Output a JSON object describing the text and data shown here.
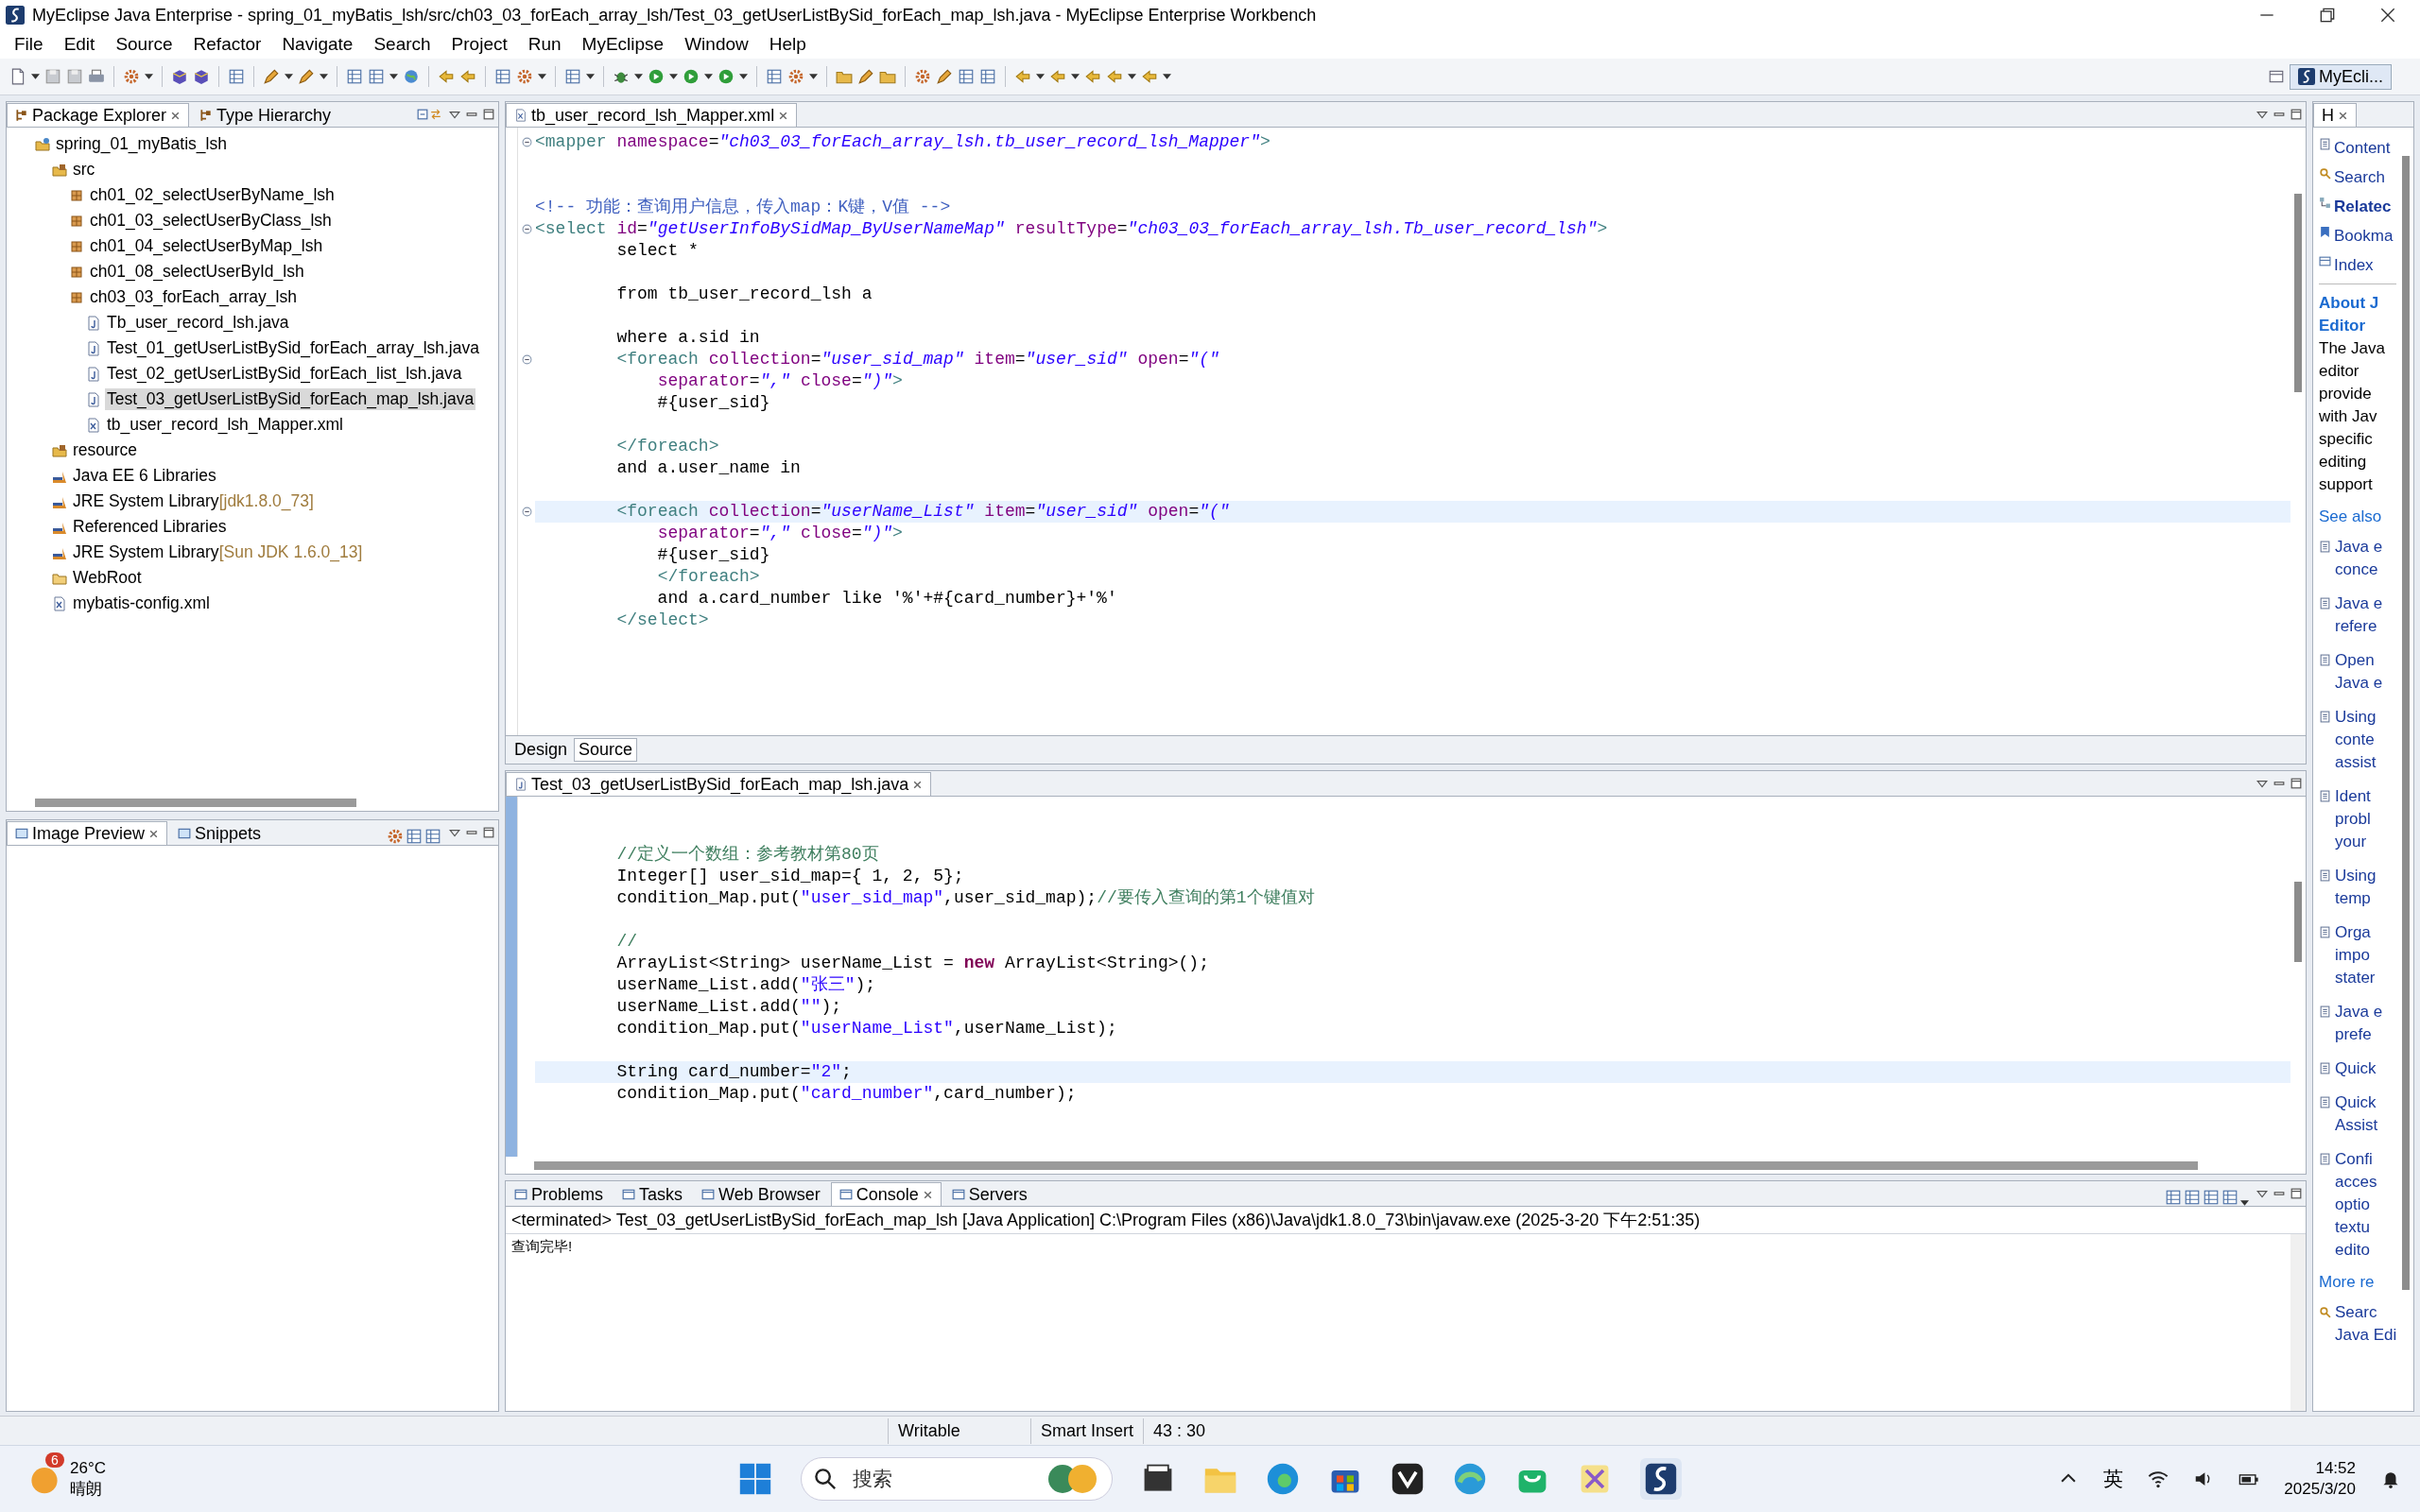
{
  "window": {
    "title": "MyEclipse Java Enterprise - spring_01_myBatis_lsh/src/ch03_03_forEach_array_lsh/Test_03_getUserListBySid_forEach_map_lsh.java - MyEclipse Enterprise Workbench"
  },
  "menu": [
    "File",
    "Edit",
    "Source",
    "Refactor",
    "Navigate",
    "Search",
    "Project",
    "Run",
    "MyEclipse",
    "Window",
    "Help"
  ],
  "perspective": {
    "label": "MyEcli..."
  },
  "explorer": {
    "tabs": [
      {
        "label": "Package Explorer",
        "selected": true
      },
      {
        "label": "Type Hierarchy",
        "selected": false
      }
    ],
    "tree": [
      {
        "label": "spring_01_myBatis_lsh",
        "kind": "project",
        "selected": false,
        "children": [
          {
            "label": "src",
            "kind": "source",
            "selected": false,
            "children": [
              {
                "label": "ch01_02_selectUserByName_lsh",
                "kind": "package",
                "selected": false
              },
              {
                "label": "ch01_03_selectUserByClass_lsh",
                "kind": "package",
                "selected": false
              },
              {
                "label": "ch01_04_selectUserByMap_lsh",
                "kind": "package",
                "selected": false
              },
              {
                "label": "ch01_08_selectUserById_lsh",
                "kind": "package",
                "selected": false
              },
              {
                "label": "ch03_03_forEach_array_lsh",
                "kind": "package",
                "selected": false,
                "children": [
                  {
                    "label": "Tb_user_record_lsh.java",
                    "kind": "java",
                    "selected": false
                  },
                  {
                    "label": "Test_01_getUserListBySid_forEach_array_lsh.java",
                    "kind": "java",
                    "selected": false
                  },
                  {
                    "label": "Test_02_getUserListBySid_forEach_list_lsh.java",
                    "kind": "java",
                    "selected": false
                  },
                  {
                    "label": "Test_03_getUserListBySid_forEach_map_lsh.java",
                    "kind": "java",
                    "selected": true
                  },
                  {
                    "label": "tb_user_record_lsh_Mapper.xml",
                    "kind": "xml",
                    "selected": false
                  }
                ]
              }
            ]
          },
          {
            "label": "resource",
            "kind": "source",
            "selected": false
          },
          {
            "label": "Java EE 6 Libraries",
            "kind": "library",
            "selected": false
          },
          {
            "label": "JRE System Library",
            "decoration": "[jdk1.8.0_73]",
            "kind": "library",
            "selected": false
          },
          {
            "label": "Referenced Libraries",
            "kind": "library",
            "selected": false
          },
          {
            "label": "JRE System Library",
            "decoration": "[Sun JDK 1.6.0_13]",
            "kind": "library",
            "selected": false
          },
          {
            "label": "WebRoot",
            "kind": "folder",
            "selected": false
          },
          {
            "label": "mybatis-config.xml",
            "kind": "xml",
            "selected": false
          }
        ]
      }
    ]
  },
  "preview": {
    "tabs": [
      {
        "label": "Image Preview",
        "selected": true
      },
      {
        "label": "Snippets",
        "selected": false
      }
    ]
  },
  "xml_editor": {
    "tab": "tb_user_record_lsh_Mapper.xml",
    "lines": [
      {
        "fold": true,
        "current": false,
        "text": "<mapper namespace=\"ch03_03_forEach_array_lsh.tb_user_record_lsh_Mapper\">"
      },
      {
        "fold": false,
        "current": false
      },
      {
        "fold": false,
        "current": false
      },
      {
        "fold": false,
        "current": false,
        "text": "<!-- 功能：查询用户信息，传入map：K键，V值 -->"
      },
      {
        "fold": true,
        "current": false,
        "text": "<select id=\"getUserInfoBySidMap_ByUserNameMap\" resultType=\"ch03_03_forEach_array_lsh.Tb_user_record_lsh\">"
      },
      {
        "fold": false,
        "current": false,
        "text": "        select *"
      },
      {
        "fold": false,
        "current": false
      },
      {
        "fold": false,
        "current": false,
        "text": "        from tb_user_record_lsh a"
      },
      {
        "fold": false,
        "current": false
      },
      {
        "fold": false,
        "current": false,
        "text": "        where a.sid in"
      },
      {
        "fold": true,
        "current": false,
        "text": "        <foreach collection=\"user_sid_map\" item=\"user_sid\" open=\"(\""
      },
      {
        "fold": false,
        "current": false,
        "text": "            separator=\",\" close=\")\">"
      },
      {
        "fold": false,
        "current": false,
        "text": "            #{user_sid}"
      },
      {
        "fold": false,
        "current": false
      },
      {
        "fold": false,
        "current": false,
        "text": "        </foreach>"
      },
      {
        "fold": false,
        "current": false,
        "text": "        and a.user_name in"
      },
      {
        "fold": false,
        "current": false
      },
      {
        "fold": true,
        "current": true,
        "text": "        <foreach collection=\"userName_List\" item=\"user_sid\" open=\"(\""
      },
      {
        "fold": false,
        "current": false,
        "text": "            separator=\",\" close=\")\">"
      },
      {
        "fold": false,
        "current": false,
        "text": "            #{user_sid}"
      },
      {
        "fold": false,
        "current": false,
        "text": "            </foreach>"
      },
      {
        "fold": false,
        "current": false,
        "text": "            and a.card_number like '%'+#{card_number}+'%'"
      },
      {
        "fold": false,
        "current": false,
        "text": "        </select>"
      }
    ],
    "view_tabs": [
      {
        "label": "Design",
        "selected": false
      },
      {
        "label": "Source",
        "selected": true
      }
    ]
  },
  "java_editor": {
    "tab": "Test_03_getUserListBySid_forEach_map_lsh.java",
    "lines": [
      {
        "fold": false,
        "current": false
      },
      {
        "fold": false,
        "current": false
      },
      {
        "fold": false,
        "current": false,
        "text": "        //定义一个数组：参考教材第80页"
      },
      {
        "fold": false,
        "current": false,
        "text": "        Integer[] user_sid_map={ 1, 2, 5};"
      },
      {
        "fold": false,
        "current": false,
        "text": "        condition_Map.put(\"user_sid_map\",user_sid_map);//要传入查询的第1个键值对"
      },
      {
        "fold": false,
        "current": false
      },
      {
        "fold": false,
        "current": false,
        "text": "        //"
      },
      {
        "fold": false,
        "current": false,
        "text": "        ArrayList<String> userName_List = new ArrayList<String>();"
      },
      {
        "fold": false,
        "current": false,
        "text": "        userName_List.add(\"张三\");"
      },
      {
        "fold": false,
        "current": false,
        "text": "        userName_List.add(\"\");"
      },
      {
        "fold": false,
        "current": false,
        "text": "        condition_Map.put(\"userName_List\",userName_List);"
      },
      {
        "fold": false,
        "current": false
      },
      {
        "fold": false,
        "current": true,
        "text": "        String card_number=\"2\";"
      },
      {
        "fold": false,
        "current": false,
        "text": "        condition_Map.put(\"card_number\",card_number);"
      }
    ]
  },
  "console": {
    "tabs": [
      {
        "label": "Problems",
        "selected": false
      },
      {
        "label": "Tasks",
        "selected": false
      },
      {
        "label": "Web Browser",
        "selected": false
      },
      {
        "label": "Console",
        "selected": true
      },
      {
        "label": "Servers",
        "selected": false
      }
    ],
    "header": "<terminated> Test_03_getUserListBySid_forEach_map_lsh [Java Application] C:\\Program Files (x86)\\Java\\jdk1.8.0_73\\bin\\javaw.exe (2025-3-20 下午2:51:35)",
    "output": "查询完毕!"
  },
  "help": {
    "tab": "H",
    "nav": [
      {
        "label": "Content",
        "kind": "contents",
        "selected": false
      },
      {
        "label": "Search",
        "kind": "search",
        "selected": false
      },
      {
        "label": "Relatec",
        "kind": "related",
        "selected": true
      },
      {
        "label": "Bookma",
        "kind": "bookmarks",
        "selected": false
      },
      {
        "label": "Index",
        "kind": "index",
        "selected": false
      }
    ],
    "title": [
      "About J",
      "Editor"
    ],
    "body": [
      "The Java",
      "editor",
      "provide",
      "with Jav",
      "specific",
      "editing",
      "support"
    ],
    "see_also": "See also",
    "links": [
      [
        "Java e",
        "conce"
      ],
      [
        "Java e",
        "refere"
      ],
      [
        "Open",
        "Java e"
      ],
      [
        "Using",
        "conte",
        "assist"
      ],
      [
        "Ident",
        "probl",
        "your"
      ],
      [
        "Using",
        "temp"
      ],
      [
        "Orga",
        "impo",
        "stater"
      ],
      [
        "Java e",
        "prefe"
      ],
      [
        "Quick"
      ],
      [
        "Quick",
        "Assist"
      ],
      [
        "Confi",
        "acces",
        "optio",
        "textu",
        "edito"
      ]
    ],
    "more": "More re",
    "search_link": [
      "Searc",
      "Java Edi"
    ]
  },
  "status_bar": [
    "Writable",
    "Smart Insert",
    "43 : 30"
  ],
  "taskbar": {
    "weather": {
      "badge": "6",
      "temp": "26°C",
      "condition": "晴朗"
    },
    "search": {
      "placeholder": "搜索"
    },
    "ime": "英",
    "time": "14:52",
    "date": "2025/3/20"
  }
}
